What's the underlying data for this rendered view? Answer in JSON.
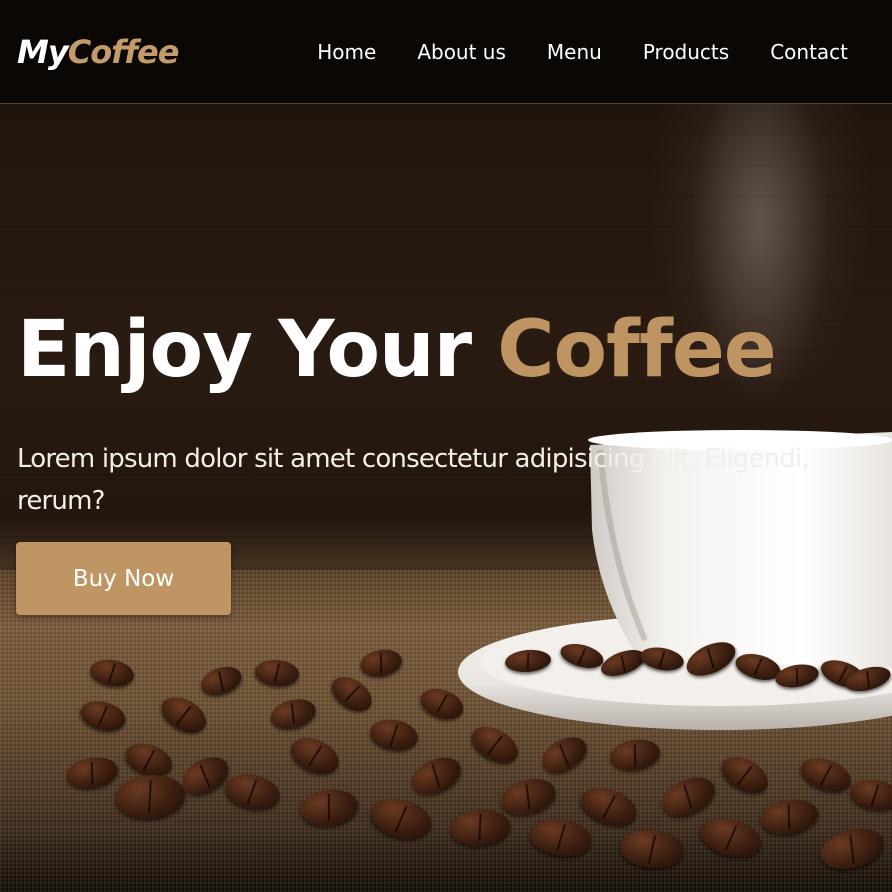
{
  "logo": {
    "part1": "My",
    "part2": "Coffee"
  },
  "nav": {
    "items": [
      "Home",
      "About us",
      "Menu",
      "Products",
      "Contact"
    ]
  },
  "hero": {
    "title_main": "Enjoy Your",
    "title_accent": "Coffee",
    "text": "Lorem ipsum dolor sit amet consectetur adipisicing elit. Eligendi, rerum?",
    "button_label": "Buy Now"
  },
  "colors": {
    "accent": "#bd9462",
    "header_bg": "#0a0705",
    "button_bg": "#bf9563"
  },
  "images": {
    "background": "coffee-cup-and-beans-photo"
  }
}
